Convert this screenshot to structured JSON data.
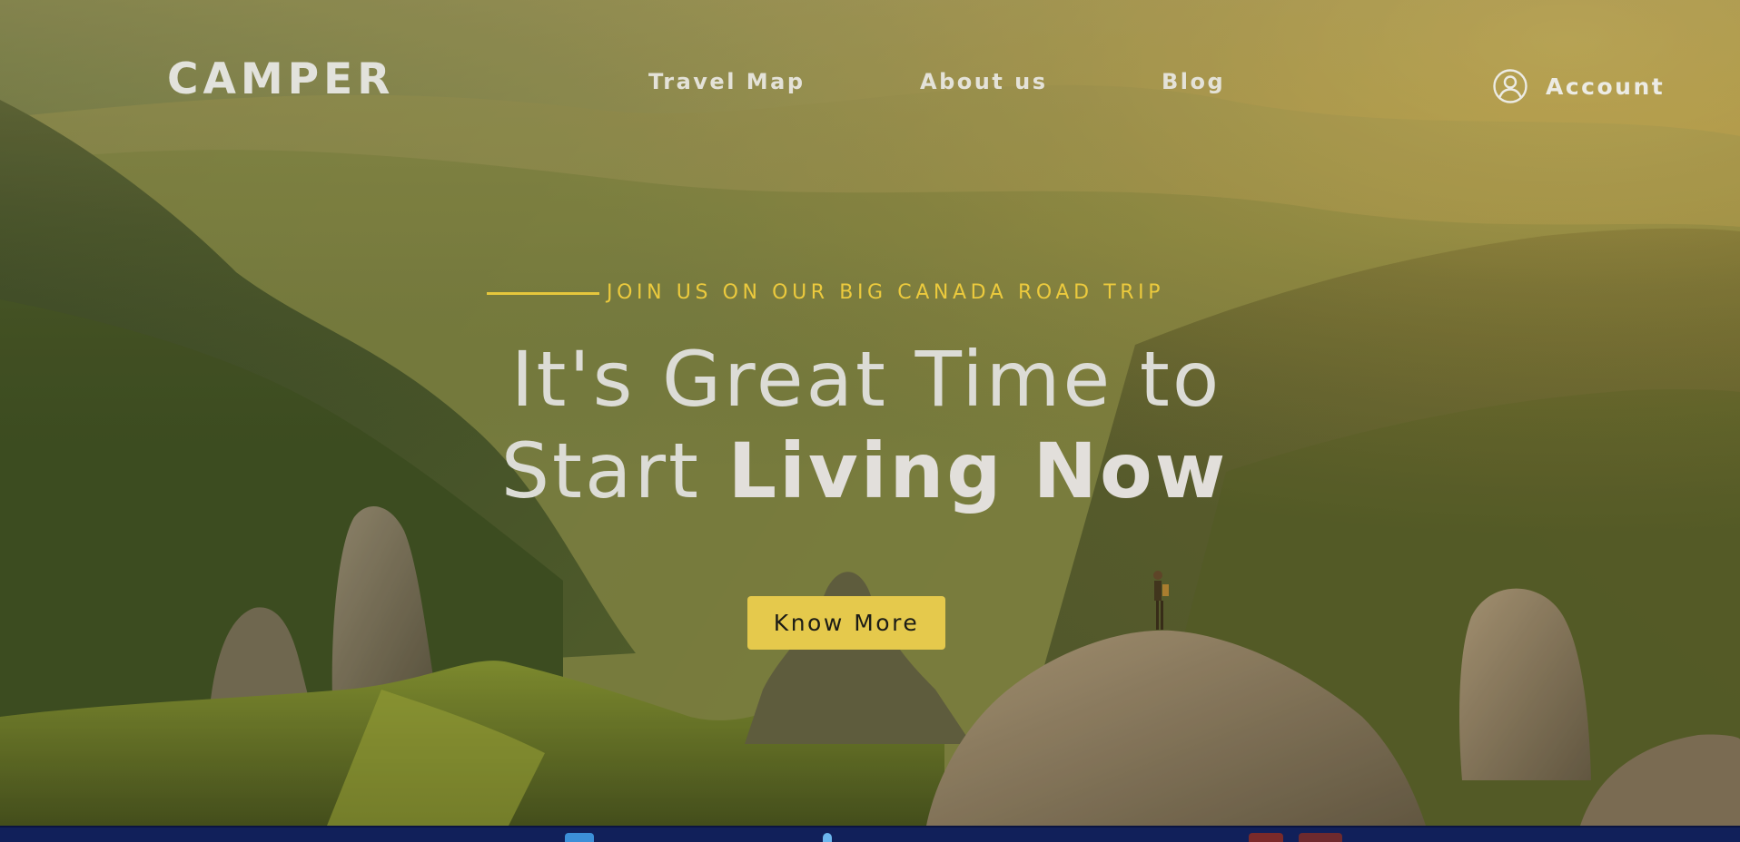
{
  "nav": {
    "logo": "CAMPER",
    "links": [
      {
        "label": "Travel Map"
      },
      {
        "label": "About us"
      },
      {
        "label": "Blog"
      }
    ],
    "account_label": "Account"
  },
  "hero": {
    "tagline": "JOIN US ON OUR BIG CANADA ROAD TRIP",
    "headline_line1": "It's Great Time to",
    "headline_line2_light": "Start ",
    "headline_line2_bold": "Living Now",
    "cta_label": "Know More"
  },
  "colors": {
    "accent": "#e5c94c",
    "tagline": "#ecca3d",
    "taskbar": "#11205a"
  },
  "icons": {
    "account": "user-circle-icon"
  }
}
